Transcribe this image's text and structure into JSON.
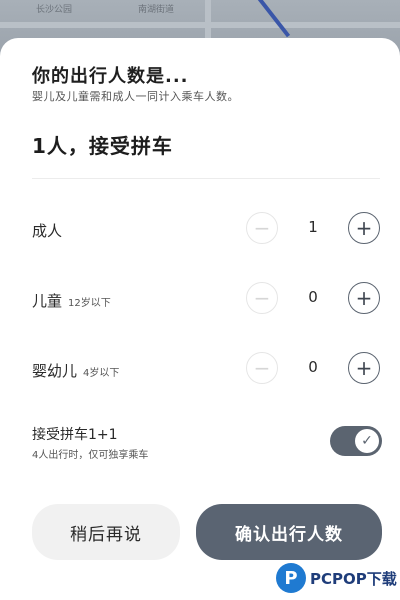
{
  "map": {
    "labels": [
      "长沙公园",
      "南湖街道"
    ]
  },
  "sheet": {
    "title": "你的出行人数是...",
    "subtitle": "婴儿及儿童需和成人一同计入乘车人数。",
    "summary": "1人，接受拼车"
  },
  "passengers": [
    {
      "label": "成人",
      "note": "",
      "value": "1",
      "minus": "−",
      "plus": "+"
    },
    {
      "label": "儿童",
      "note": "12岁以下",
      "value": "0",
      "minus": "−",
      "plus": "+"
    },
    {
      "label": "婴幼儿",
      "note": "4岁以下",
      "value": "0",
      "minus": "−",
      "plus": "+"
    }
  ],
  "carpool": {
    "label": "接受拼车1+1",
    "note": "4人出行时，仅可独享乘车",
    "enabled": true,
    "check": "✓"
  },
  "actions": {
    "later": "稍后再说",
    "confirm": "确认出行人数"
  },
  "watermark": {
    "logo": "P",
    "text": "PCPOP下载"
  },
  "colors": {
    "accent": "#5a6472",
    "background_map": "#9aa3ad"
  }
}
